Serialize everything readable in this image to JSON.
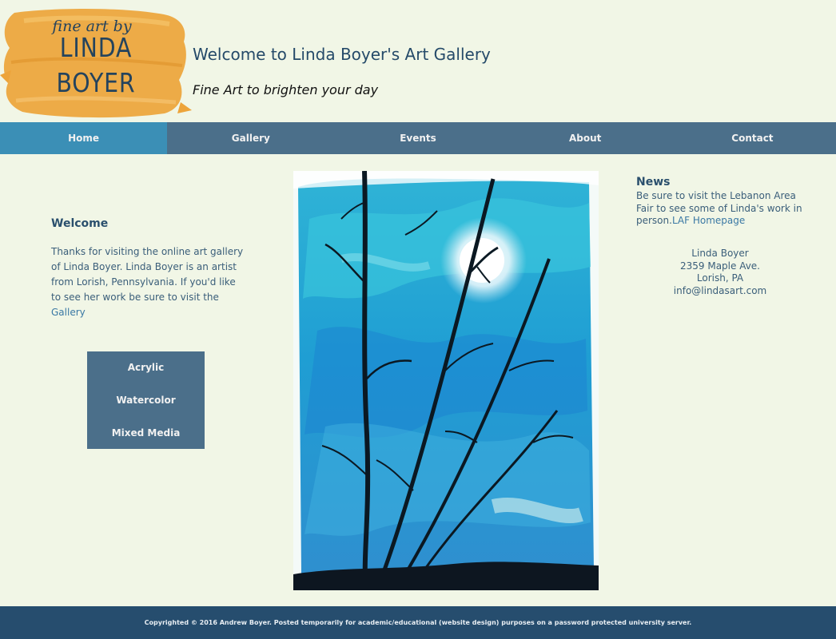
{
  "header": {
    "logo": {
      "line1": "fine art by",
      "line2": "LINDA",
      "line3": "BOYER"
    },
    "title": "Welcome to Linda Boyer's Art Gallery",
    "tagline": "Fine Art to brighten your day"
  },
  "nav": {
    "items": [
      {
        "label": "Home",
        "active": true
      },
      {
        "label": "Gallery",
        "active": false
      },
      {
        "label": "Events",
        "active": false
      },
      {
        "label": "About",
        "active": false
      },
      {
        "label": "Contact",
        "active": false
      }
    ]
  },
  "welcome": {
    "heading": "Welcome",
    "text": "Thanks for visiting the online art gallery of Linda Boyer. Linda Boyer is an artist from Lorish, Pennsylvania. If you'd like to see her work be sure to visit the",
    "link": "Gallery"
  },
  "subnav": {
    "items": [
      "Acrylic",
      "Watercolor",
      "Mixed Media"
    ]
  },
  "news": {
    "heading": "News",
    "text": "Be sure to visit the Lebanon Area Fair to see some of Linda's work in person.",
    "link": "LAF Homepage"
  },
  "contact": {
    "name": "Linda Boyer",
    "street": "2359 Maple Ave.",
    "city": "Lorish, PA",
    "email": "info@lindasart.com"
  },
  "footer": {
    "text": "Copyrighted © 2016 Andrew Boyer. Posted temporarily for academic/educational (website design) purposes on a password protected university server."
  },
  "colors": {
    "background": "#f1f6e6",
    "nav": "#4b6f8a",
    "nav_active": "#3b8fb6",
    "footer": "#264d6e",
    "heading": "#2a4f6d",
    "link": "#3a78a4",
    "logo_brush": "#eda43a"
  },
  "icons": {
    "logo": "paint-brush-stroke-logo",
    "painting": "watercolor-bamboo-moon-painting"
  }
}
